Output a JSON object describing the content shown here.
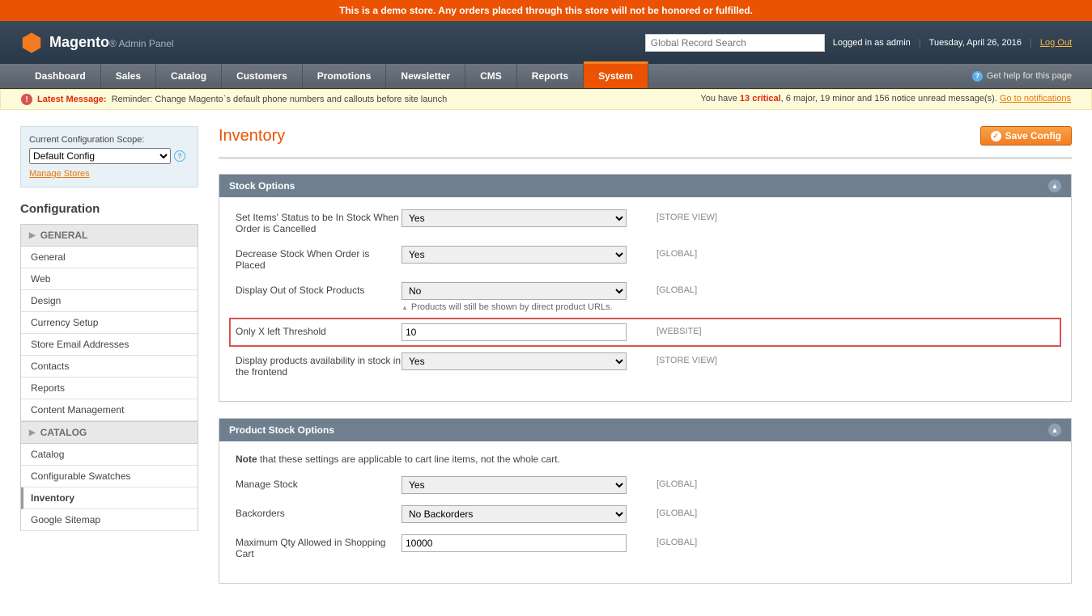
{
  "demo_banner": "This is a demo store. Any orders placed through this store will not be honored or fulfilled.",
  "logo": {
    "brand": "Magento",
    "suffix": "Admin Panel"
  },
  "header": {
    "search_placeholder": "Global Record Search",
    "logged_in": "Logged in as admin",
    "date": "Tuesday, April 26, 2016",
    "logout": "Log Out"
  },
  "nav": {
    "items": [
      "Dashboard",
      "Sales",
      "Catalog",
      "Customers",
      "Promotions",
      "Newsletter",
      "CMS",
      "Reports",
      "System"
    ],
    "active_index": 8,
    "help": "Get help for this page"
  },
  "message": {
    "latest_label": "Latest Message:",
    "latest_text": "Reminder: Change Magento`s default phone numbers and callouts before site launch",
    "summary_prefix": "You have ",
    "critical": "13 critical",
    "rest": ", 6 major, 19 minor and 156 notice unread message(s). ",
    "link": "Go to notifications"
  },
  "scope": {
    "label": "Current Configuration Scope:",
    "value": "Default Config",
    "manage": "Manage Stores"
  },
  "sidebar": {
    "title": "Configuration",
    "groups": [
      {
        "header": "GENERAL",
        "items": [
          "General",
          "Web",
          "Design",
          "Currency Setup",
          "Store Email Addresses",
          "Contacts",
          "Reports",
          "Content Management"
        ]
      },
      {
        "header": "CATALOG",
        "items": [
          "Catalog",
          "Configurable Swatches",
          "Inventory",
          "Google Sitemap"
        ],
        "active_index": 2
      }
    ]
  },
  "content": {
    "title": "Inventory",
    "save": "Save Config",
    "sections": [
      {
        "title": "Stock Options",
        "fields": [
          {
            "label": "Set Items' Status to be In Stock When Order is Cancelled",
            "value": "Yes",
            "type": "select",
            "scope": "[STORE VIEW]"
          },
          {
            "label": "Decrease Stock When Order is Placed",
            "value": "Yes",
            "type": "select",
            "scope": "[GLOBAL]"
          },
          {
            "label": "Display Out of Stock Products",
            "value": "No",
            "type": "select",
            "scope": "[GLOBAL]",
            "note": "Products will still be shown by direct product URLs."
          },
          {
            "label": "Only X left Threshold",
            "value": "10",
            "type": "text",
            "scope": "[WEBSITE]",
            "highlight": true
          },
          {
            "label": "Display products availability in stock in the frontend",
            "value": "Yes",
            "type": "select",
            "scope": "[STORE VIEW]"
          }
        ]
      },
      {
        "title": "Product Stock Options",
        "note_html_bold": "Note",
        "note_html": " that these settings are applicable to cart line items, not the whole cart.",
        "fields": [
          {
            "label": "Manage Stock",
            "value": "Yes",
            "type": "select",
            "scope": "[GLOBAL]"
          },
          {
            "label": "Backorders",
            "value": "No Backorders",
            "type": "select",
            "scope": "[GLOBAL]"
          },
          {
            "label": "Maximum Qty Allowed in Shopping Cart",
            "value": "10000",
            "type": "text",
            "scope": "[GLOBAL]"
          }
        ]
      }
    ]
  }
}
